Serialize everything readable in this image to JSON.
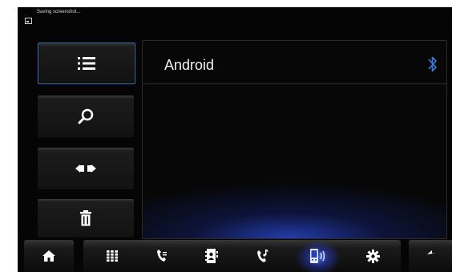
{
  "status_bar": {
    "notification_text": "Saving screenshot...",
    "notification_icon": "image-icon"
  },
  "side_menu": [
    {
      "name": "list",
      "icon": "list-icon",
      "selected": true
    },
    {
      "name": "search",
      "icon": "search-icon",
      "selected": false
    },
    {
      "name": "connect",
      "icon": "connect-icon",
      "selected": false
    },
    {
      "name": "delete",
      "icon": "trash-icon",
      "selected": false
    }
  ],
  "panel": {
    "device_name": "Android",
    "connection_icon": "bluetooth-icon"
  },
  "bottom_nav": [
    {
      "name": "home",
      "icon": "home-icon"
    },
    {
      "name": "dialpad",
      "icon": "dialpad-icon"
    },
    {
      "name": "call-log",
      "icon": "call-log-icon"
    },
    {
      "name": "contacts",
      "icon": "contacts-icon"
    },
    {
      "name": "music-call",
      "icon": "phone-music-icon"
    },
    {
      "name": "phone-connection",
      "icon": "phone-connect-icon",
      "active": true
    },
    {
      "name": "settings",
      "icon": "gear-icon"
    },
    {
      "name": "back",
      "icon": "back-icon"
    }
  ],
  "colors": {
    "background": "#050505",
    "accent_blue": "#3b6fb8",
    "bluetooth": "#3a7de0",
    "text": "#f2f2f2"
  }
}
